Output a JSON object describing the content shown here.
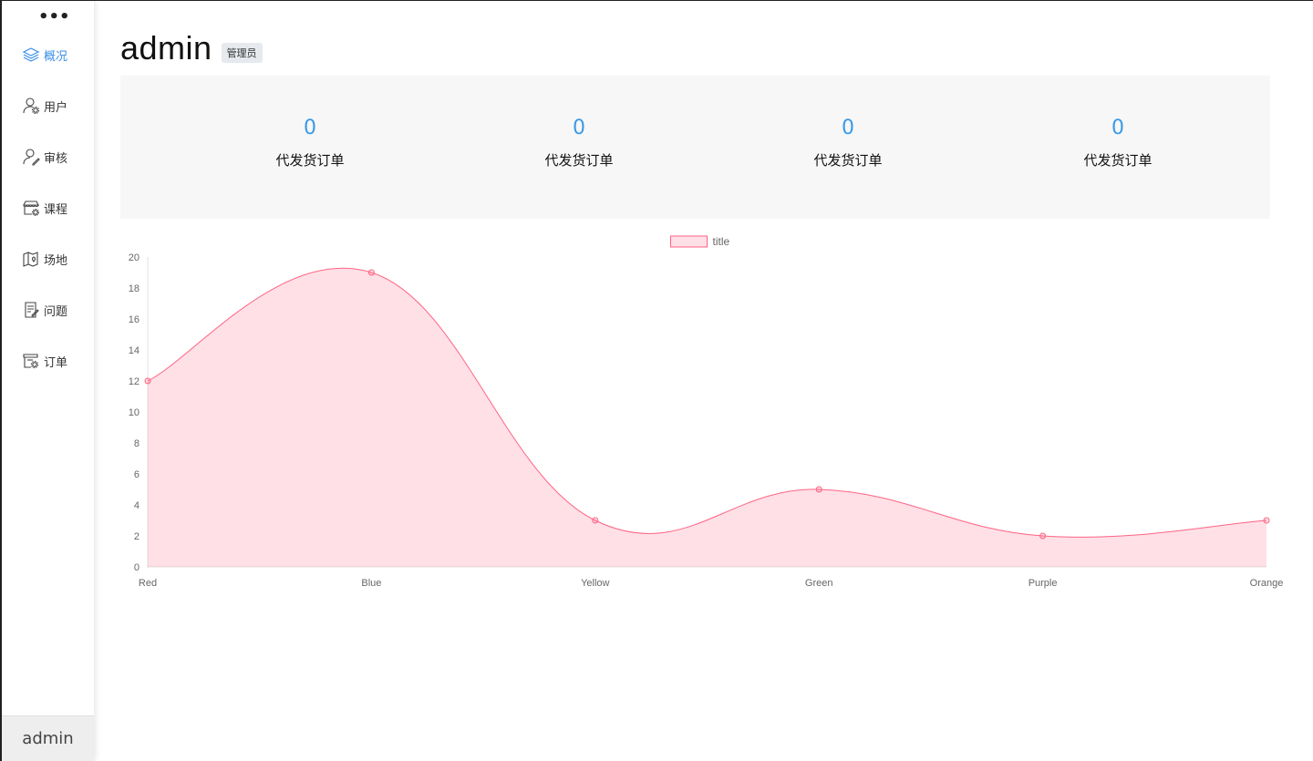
{
  "sidebar": {
    "more_label": "•••",
    "items": [
      {
        "label": "概况",
        "icon": "layers-icon",
        "active": true
      },
      {
        "label": "用户",
        "icon": "user-gear-icon",
        "active": false
      },
      {
        "label": "审核",
        "icon": "user-edit-icon",
        "active": false
      },
      {
        "label": "课程",
        "icon": "storefront-icon",
        "active": false
      },
      {
        "label": "场地",
        "icon": "map-pin-icon",
        "active": false
      },
      {
        "label": "问题",
        "icon": "document-edit-icon",
        "active": false
      },
      {
        "label": "订单",
        "icon": "order-gear-icon",
        "active": false
      }
    ],
    "footer_user": "admin"
  },
  "header": {
    "title": "admin",
    "role_badge": "管理员"
  },
  "stats": [
    {
      "value": "0",
      "label": "代发货订单"
    },
    {
      "value": "0",
      "label": "代发货订单"
    },
    {
      "value": "0",
      "label": "代发货订单"
    },
    {
      "value": "0",
      "label": "代发货订单"
    }
  ],
  "colors": {
    "accent": "#3a8ee6",
    "stat_value": "#3a9ae6",
    "line": "#ff6384",
    "fill": "rgba(255,99,132,0.2)"
  },
  "chart_data": {
    "type": "area",
    "categories": [
      "Red",
      "Blue",
      "Yellow",
      "Green",
      "Purple",
      "Orange"
    ],
    "series": [
      {
        "name": "title",
        "values": [
          12,
          19,
          3,
          5,
          2,
          3
        ]
      }
    ],
    "ylim": [
      0,
      20
    ],
    "yticks": [
      0,
      2,
      4,
      6,
      8,
      10,
      12,
      14,
      16,
      18,
      20
    ],
    "grid": false,
    "legend": "top-center"
  }
}
